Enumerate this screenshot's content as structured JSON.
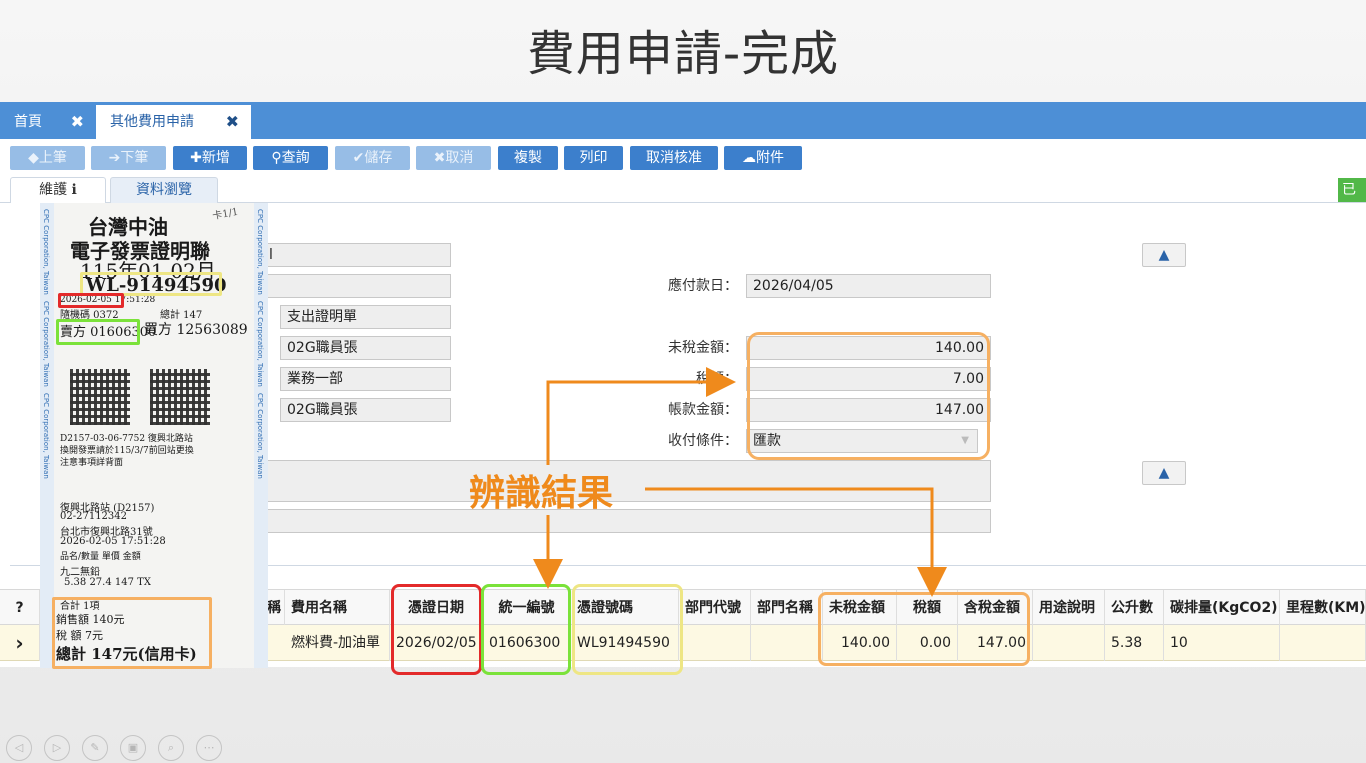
{
  "slide": {
    "title": "費用申請-完成"
  },
  "tabs": [
    {
      "label": "首頁",
      "close": "✖"
    },
    {
      "label": "其他費用申請",
      "close": "✖"
    }
  ],
  "toolbar": {
    "prev": "◆上筆",
    "next": "➔下筆",
    "add": "✚新增",
    "query": "查詢",
    "save": "✔儲存",
    "cancel": "✖取消",
    "copy": "複製",
    "print": "列印",
    "cancel_approve": "取消核准",
    "attach": "附件"
  },
  "subtabs": {
    "maintain": "維護 ℹ",
    "browse": "資料瀏覽",
    "status_tag": "已"
  },
  "form": {
    "due_date_label": "應付款日：",
    "due_date": "2026/04/05",
    "field_fragment": "l",
    "doc_type": "支出證明單",
    "applicant": "02G職員張",
    "department": "業務一部",
    "payee": "02G職員張",
    "pretax_label": "未稅金額：",
    "pretax": "140.00",
    "tax_label": "稅額：",
    "tax": "7.00",
    "total_label": "帳款金額：",
    "total": "147.00",
    "terms_label": "收付條件：",
    "terms": "匯款",
    "up_glyph": "▲"
  },
  "grid": {
    "headers": [
      "費用名稱",
      "憑證日期",
      "統一編號",
      "憑證號碼",
      "部門代號",
      "部門名稱",
      "未稅金額",
      "稅額",
      "含稅金額",
      "用途說明",
      "公升數",
      "碳排量(KgCO2)",
      "里程數(KM)"
    ],
    "row": [
      "燃料費-加油單",
      "2026/02/05",
      "01606300",
      "WL91494590",
      "",
      "",
      "140.00",
      "0.00",
      "147.00",
      "",
      "5.38",
      "10",
      ""
    ],
    "help_glyph": "?",
    "row_marker": "›",
    "hidden_header": "稱"
  },
  "annotation": {
    "result": "辨識結果"
  },
  "receipt": {
    "company": "台灣中油",
    "handwritten": "卡1/1",
    "title": "電子發票證明聯",
    "period": "115年01-02月",
    "number": "WL-91494590",
    "datetime": "2026-02-05 17:51:28",
    "random": "隨機碼 0372",
    "total_line": "總計 147",
    "seller": "賣方 01606300",
    "buyer": "買方 12563089",
    "station_code": "D2157-03-06-7752 復興北路站",
    "note1": "換開發票請於115/3/7前回站更換",
    "note2": "注意事項詳背面",
    "station": "復興北路站 (D2157)",
    "phone": "02-27112342",
    "address": "台北市復興北路31號",
    "date2": "2026-02-05 17:51:28",
    "cols": "品名/數量    單價       金額",
    "item": "九二無鉛",
    "item_vals": "5.38        27.4        147 TX",
    "sum": "合計    1項",
    "sales": "銷售額  140元",
    "tax": "稅  額  7元",
    "grand": "總計   147元(信用卡)",
    "edge_text": "CPC Corporation, Taiwan"
  },
  "nav": [
    "◁",
    "▷",
    "✎",
    "▣",
    "⌕",
    "⋯"
  ]
}
